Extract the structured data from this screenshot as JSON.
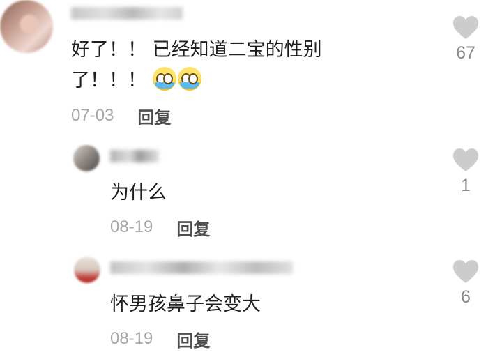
{
  "comments": [
    {
      "text_line1": "好了！！ 已经知道二宝的性别",
      "text_line2": "了！！！",
      "emojis": [
        "crying-laughing-emoji",
        "crying-laughing-emoji"
      ],
      "date": "07-03",
      "reply_label": "回复",
      "likes": "67"
    },
    {
      "text": "为什么",
      "date": "08-19",
      "reply_label": "回复",
      "likes": "1"
    },
    {
      "text": "怀男孩鼻子会变大",
      "date": "08-19",
      "reply_label": "回复",
      "likes": "6"
    }
  ],
  "colors": {
    "text": "#1f1f1f",
    "meta": "#a6a6a6",
    "reply": "#4d4d4d",
    "heart": "#cccccc",
    "count": "#8a8a8a"
  }
}
